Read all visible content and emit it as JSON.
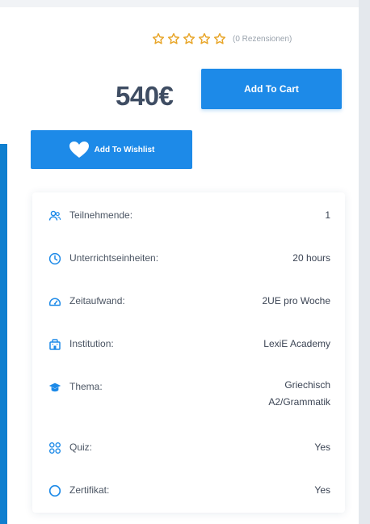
{
  "rating": {
    "stars": 5,
    "filled": 0,
    "review_text": "(0 Rezensionen)",
    "star_color": "#e8a528"
  },
  "price": {
    "amount": "540€"
  },
  "buttons": {
    "add_to_cart": "Add To Cart",
    "add_to_wishlist": "Add To Wishlist"
  },
  "colors": {
    "accent": "#1d8ae8",
    "price_text": "#3f4d63",
    "icon": "#1d8ae8"
  },
  "details": [
    {
      "icon": "users-icon",
      "label": "Teilnehmende:",
      "value_lines": [
        "1"
      ]
    },
    {
      "icon": "clock-icon",
      "label": "Unterrichtseinheiten:",
      "value_lines": [
        "20 hours"
      ]
    },
    {
      "icon": "gauge-icon",
      "label": "Zeitaufwand:",
      "value_lines": [
        "2UE pro Woche"
      ]
    },
    {
      "icon": "building-icon",
      "label": "Institution:",
      "value_lines": [
        "LexiE Academy"
      ]
    },
    {
      "icon": "graduation-cap-icon",
      "label": "Thema:",
      "value_lines": [
        "Griechisch",
        "A2/Grammatik"
      ]
    },
    {
      "icon": "grid-icon",
      "label": "Quiz:",
      "value_lines": [
        "Yes"
      ]
    },
    {
      "icon": "circle-icon",
      "label": "Zertifikat:",
      "value_lines": [
        "Yes"
      ]
    }
  ]
}
